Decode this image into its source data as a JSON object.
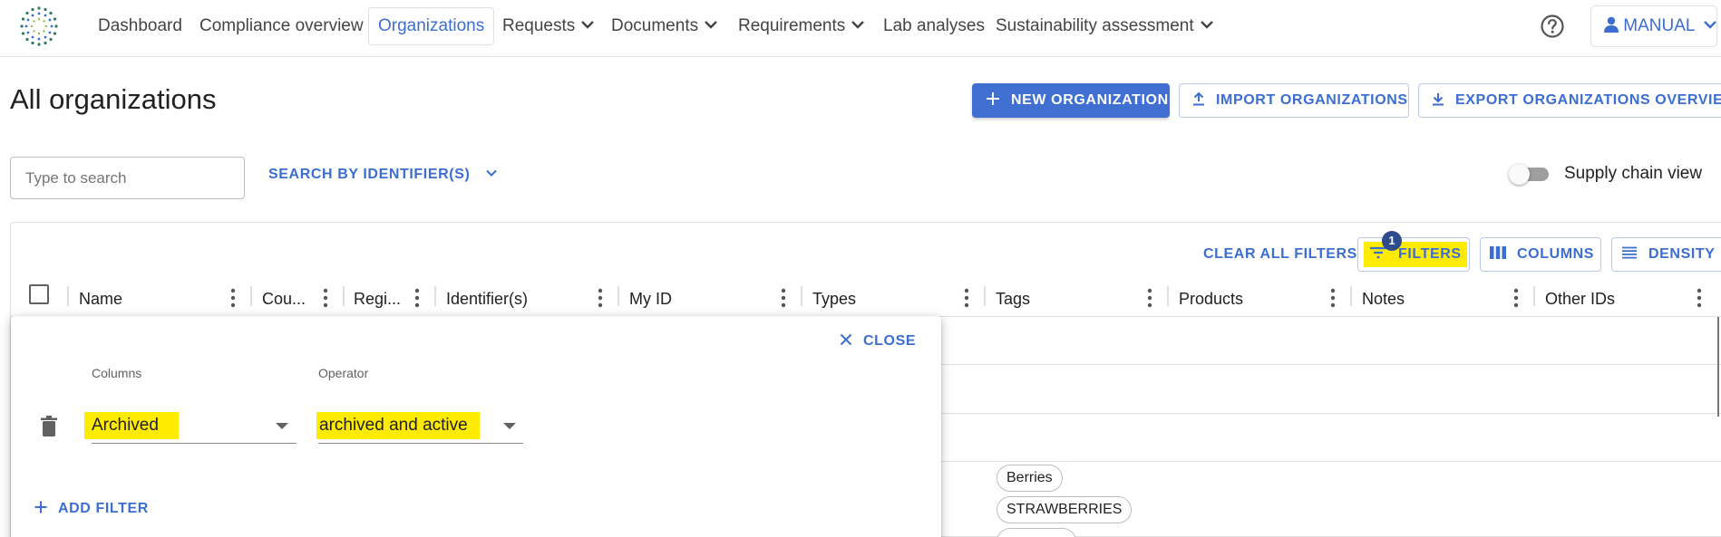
{
  "nav": {
    "items": [
      {
        "label": "Dashboard",
        "dropdown": false,
        "active": false
      },
      {
        "label": "Compliance overview",
        "dropdown": false,
        "active": false
      },
      {
        "label": "Organizations",
        "dropdown": false,
        "active": true
      },
      {
        "label": "Requests",
        "dropdown": true,
        "active": false
      },
      {
        "label": "Documents",
        "dropdown": true,
        "active": false
      },
      {
        "label": "Requirements",
        "dropdown": true,
        "active": false
      },
      {
        "label": "Lab analyses",
        "dropdown": false,
        "active": false
      },
      {
        "label": "Sustainability assessment",
        "dropdown": true,
        "active": false
      }
    ],
    "help_icon": "help-circle-icon",
    "user_label": "MANUAL"
  },
  "header": {
    "title": "All organizations",
    "new_label": "NEW ORGANIZATION",
    "import_label": "IMPORT ORGANIZATIONS",
    "export_label": "EXPORT ORGANIZATIONS OVERVIEW"
  },
  "search": {
    "placeholder": "Type to search",
    "value": "",
    "by_identifier_label": "SEARCH BY IDENTIFIER(S)",
    "supply_chain_label": "Supply chain view",
    "supply_chain_on": false
  },
  "grid": {
    "clear_filters_label": "CLEAR ALL FILTERS",
    "filters_label": "FILTERS",
    "filters_count": "1",
    "columns_label": "COLUMNS",
    "density_label": "DENSITY",
    "columns": [
      "Name",
      "Cou...",
      "Regi...",
      "Identifier(s)",
      "My ID",
      "Types",
      "Tags",
      "Products",
      "Notes",
      "Other IDs"
    ],
    "tag_chips": [
      "Berries",
      "STRAWBERRIES",
      ""
    ]
  },
  "filter_panel": {
    "close_label": "CLOSE",
    "columns_label": "Columns",
    "operator_label": "Operator",
    "column_value": "Archived",
    "operator_value": "archived and active",
    "add_filter_label": "ADD FILTER"
  },
  "colors": {
    "accent": "#3b6ed0",
    "primary_button": "#3f6fd1",
    "highlight": "#ffeb00",
    "badge": "#2e4c8c"
  }
}
